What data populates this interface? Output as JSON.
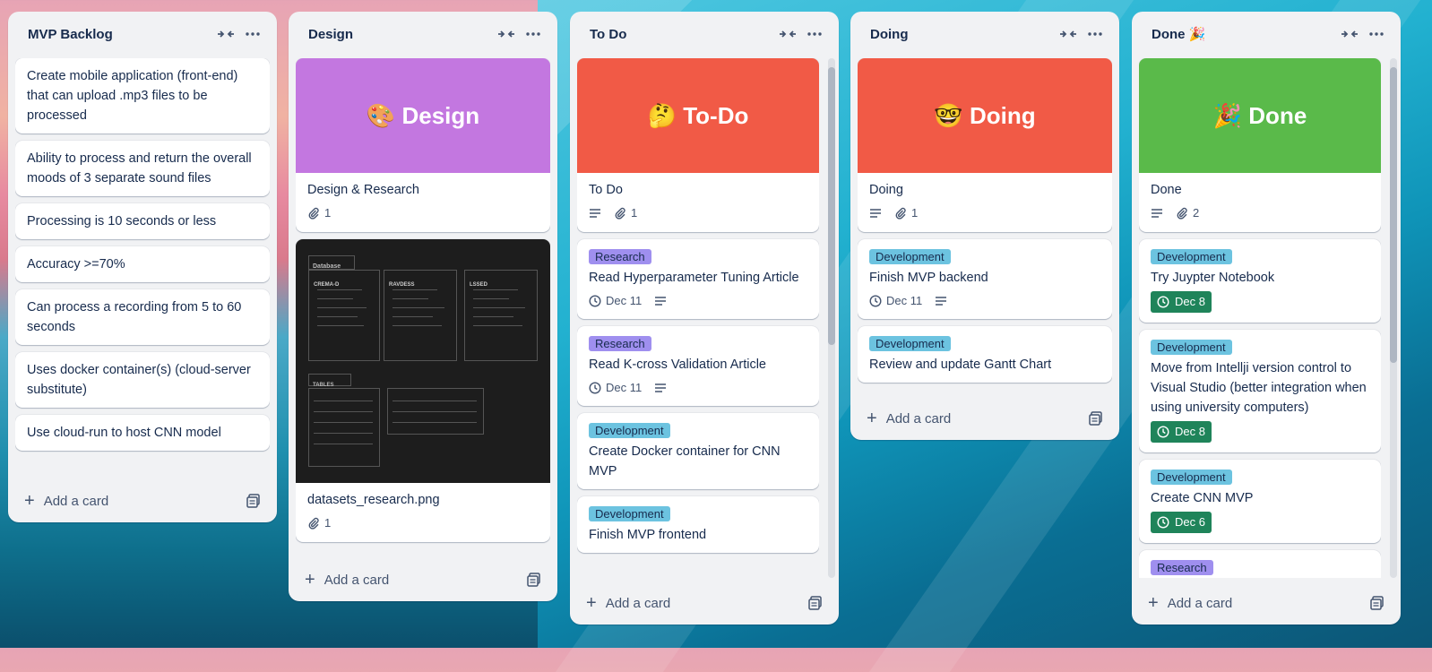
{
  "lists": [
    {
      "title": "MVP Backlog",
      "cards": [
        {
          "text": "Create mobile application (front-end) that can upload .mp3 files to be processed"
        },
        {
          "text": "Ability to process and return the overall moods of 3 separate sound files"
        },
        {
          "text": "Processing is 10 seconds or less"
        },
        {
          "text": "Accuracy >=70%"
        },
        {
          "text": "Can process a recording from 5 to 60 seconds"
        },
        {
          "text": "Uses docker container(s) (cloud-server substitute)"
        },
        {
          "text": "Use cloud-run to host CNN model"
        }
      ],
      "add_card": "Add a card"
    },
    {
      "title": "Design",
      "cards": [
        {
          "cover_text": "🎨 Design",
          "cover_color": "#c377e0",
          "title": "Design & Research",
          "attachments": "1"
        },
        {
          "image_name": "datasets_research.png",
          "title": "datasets_research.png",
          "attachments": "1",
          "image_labels": {
            "database": "Database",
            "col1": "CREMA-D",
            "col2": "RAVDESS",
            "col3": "LSSED",
            "tables": "TABLES"
          }
        }
      ],
      "add_card": "Add a card"
    },
    {
      "title": "To Do",
      "cards": [
        {
          "cover_text": "🤔 To-Do",
          "cover_color": "#f15a46",
          "title": "To Do",
          "attachments": "1"
        },
        {
          "label": "Research",
          "title": "Read Hyperparameter Tuning Article",
          "due": "Dec 11"
        },
        {
          "label": "Research",
          "title": "Read K-cross Validation Article",
          "due": "Dec 11"
        },
        {
          "label": "Development",
          "title": "Create Docker container for CNN MVP"
        },
        {
          "label": "Development",
          "title": "Finish MVP frontend"
        }
      ],
      "add_card": "Add a card"
    },
    {
      "title": "Doing",
      "cards": [
        {
          "cover_text": "🤓 Doing",
          "cover_color": "#f15a46",
          "title": "Doing",
          "attachments": "1"
        },
        {
          "label": "Development",
          "title": "Finish MVP backend",
          "due": "Dec 11"
        },
        {
          "label": "Development",
          "title": "Review and update Gantt Chart"
        }
      ],
      "add_card": "Add a card"
    },
    {
      "title": "Done 🎉",
      "cards": [
        {
          "cover_text": "🎉 Done",
          "cover_color": "#5aba4a",
          "title": "Done",
          "attachments": "2"
        },
        {
          "label": "Development",
          "title": "Try Juypter Notebook",
          "due": "Dec 8"
        },
        {
          "label": "Development",
          "title": "Move from Intellji version control to Visual Studio (better integration when using university computers)",
          "due": "Dec 8"
        },
        {
          "label": "Development",
          "title": "Create CNN MVP",
          "due": "Dec 6"
        },
        {
          "label": "Research"
        }
      ],
      "add_card": "Add a card"
    }
  ],
  "colors": {
    "research_label": "#9f8fef",
    "development_label": "#6cc3e0",
    "due_complete": "#1f845a"
  },
  "icons": {
    "collapse": "collapse-icon",
    "menu": "more-icon",
    "description": "description-icon",
    "attachment": "paperclip-icon",
    "clock": "clock-icon",
    "template": "template-icon",
    "plus": "plus-icon"
  }
}
